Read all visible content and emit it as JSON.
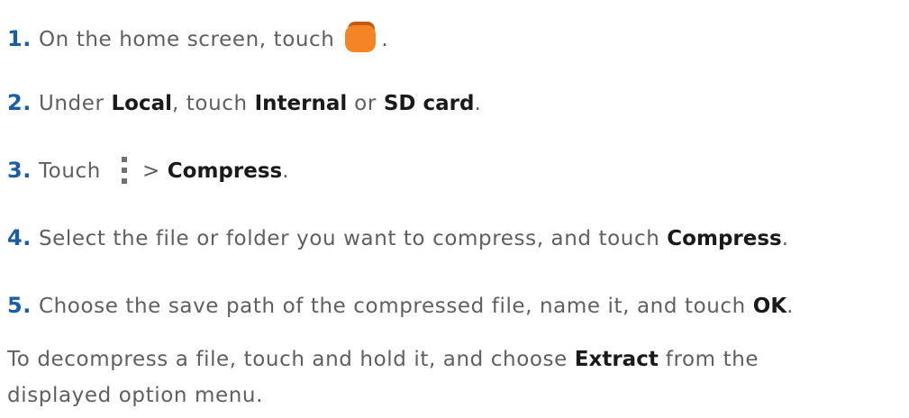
{
  "steps": [
    {
      "num": "1.",
      "t1": " On the home screen, touch ",
      "icon": "file-manager-app-icon",
      "t2": "."
    },
    {
      "num": "2.",
      "t1": " Under ",
      "b1": "Local",
      "t2": ", touch ",
      "b2": "Internal",
      "t3": " or ",
      "b3": "SD card",
      "t4": "."
    },
    {
      "num": "3.",
      "t1": " Touch",
      "icon": "more-menu-icon",
      "t2": "> ",
      "b1": "Compress",
      "t3": "."
    },
    {
      "num": "4.",
      "t1": " Select the file or folder you want to compress, and touch ",
      "b1": "Compress",
      "t2": "."
    },
    {
      "num": "5.",
      "t1": " Choose the save path of the compressed file, name it, and touch ",
      "b1": "OK",
      "t2": "."
    }
  ],
  "note": {
    "t1": "To decompress a file, touch and hold it, and choose ",
    "b1": "Extract",
    "t2": " from the",
    "t3": "displayed option menu."
  },
  "colors": {
    "step_number": "#1a5ca6",
    "body_text": "#5f5f5f",
    "bold_text": "#1a1a1a",
    "app_icon": "#f58425"
  }
}
